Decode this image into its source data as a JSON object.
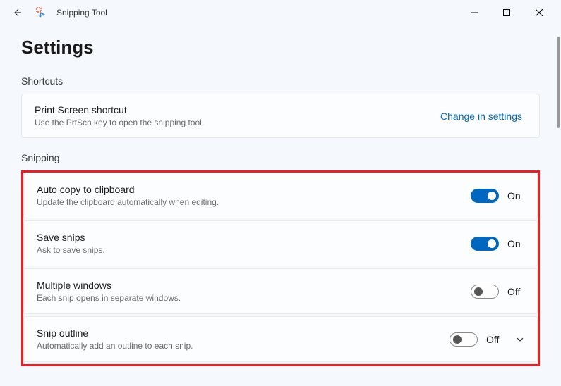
{
  "titlebar": {
    "app_name": "Snipping Tool"
  },
  "page": {
    "title": "Settings"
  },
  "sections": {
    "shortcuts": {
      "header": "Shortcuts",
      "print_screen": {
        "title": "Print Screen shortcut",
        "desc": "Use the PrtScn key to open the snipping tool.",
        "link": "Change in settings"
      }
    },
    "snipping": {
      "header": "Snipping",
      "auto_copy": {
        "title": "Auto copy to clipboard",
        "desc": "Update the clipboard automatically when editing.",
        "state": "On"
      },
      "save_snips": {
        "title": "Save snips",
        "desc": "Ask to save snips.",
        "state": "On"
      },
      "multiple_windows": {
        "title": "Multiple windows",
        "desc": "Each snip opens in separate windows.",
        "state": "Off"
      },
      "snip_outline": {
        "title": "Snip outline",
        "desc": "Automatically add an outline to each snip.",
        "state": "Off"
      }
    }
  }
}
